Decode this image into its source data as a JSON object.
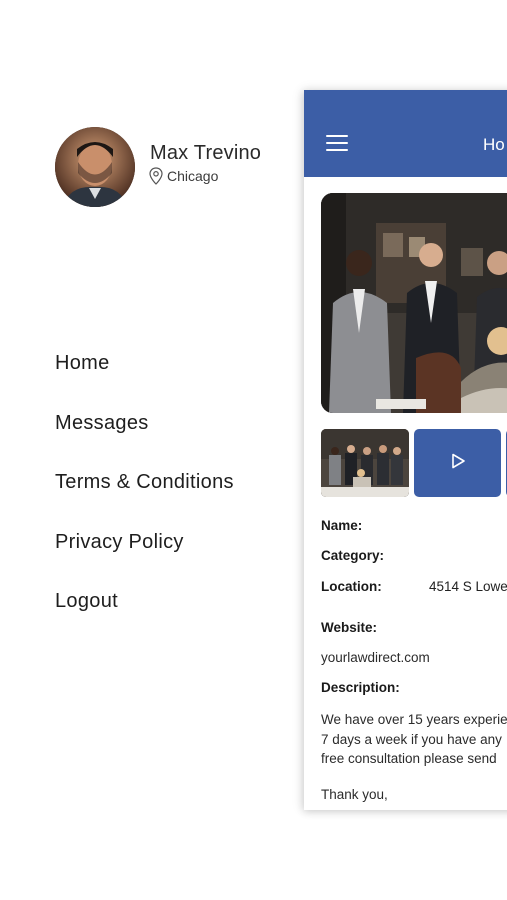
{
  "profile": {
    "name": "Max Trevino",
    "location": "Chicago"
  },
  "menu": {
    "items": [
      "Home",
      "Messages",
      "Terms & Conditions",
      "Privacy Policy",
      "Logout"
    ]
  },
  "header": {
    "title": "Ho"
  },
  "details": {
    "name_label": "Name:",
    "category_label": "Category:",
    "location_label": "Location:",
    "location_value": "4514 S Lowe",
    "website_label": "Website:",
    "website_value": "yourlawdirect.com",
    "description_label": "Description:",
    "description_lines": [
      "We have over 15 years experie",
      "7 days a week if you have any",
      "free consultation please send"
    ],
    "closing": "Thank you,"
  },
  "colors": {
    "brand": "#3c5ea6",
    "panel_bg": "#ffffff"
  },
  "icons": {
    "menu": "hamburger-icon",
    "location": "pin-icon",
    "play": "play-icon"
  }
}
